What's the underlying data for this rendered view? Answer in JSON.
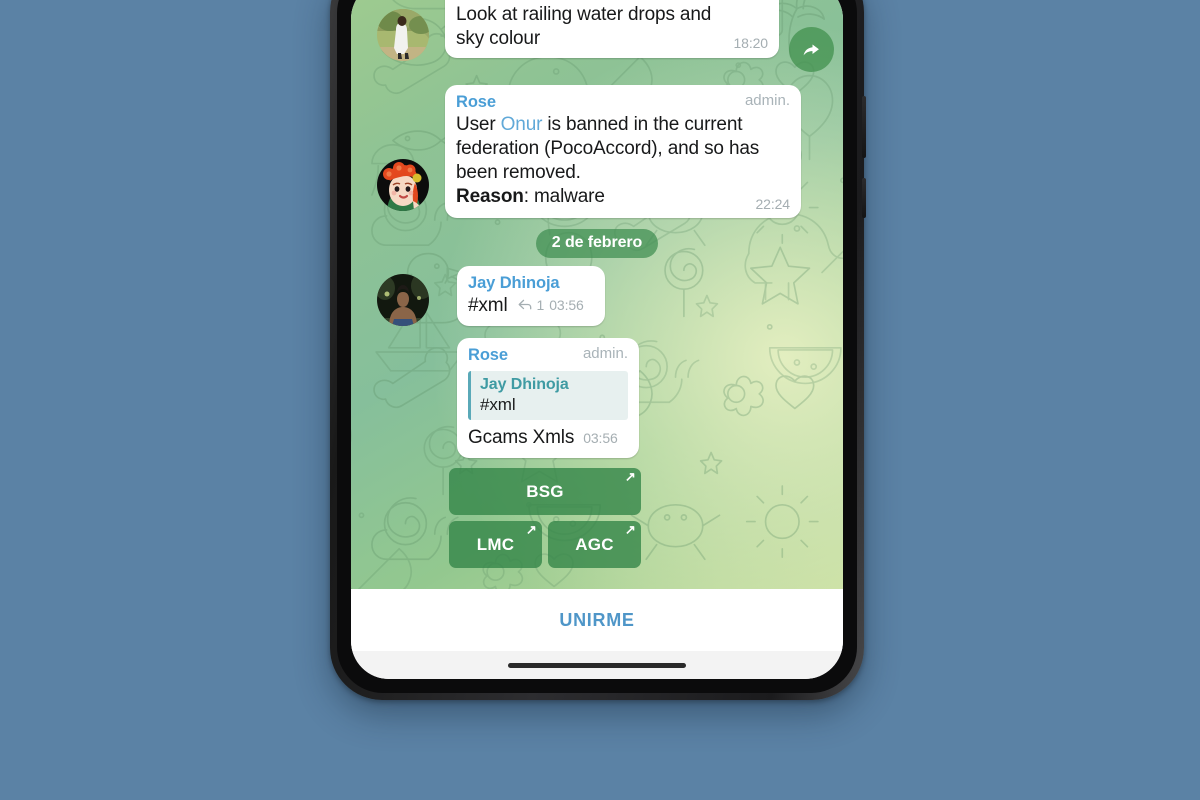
{
  "app": {
    "name": "Telegram",
    "platform": "Android phone mockup"
  },
  "theme": {
    "page_background": "#5b82a5",
    "chat_gradient_start": "#9fcb8f",
    "chat_gradient_end": "#c5dd9e",
    "bubble_background": "#ffffff",
    "sender_name_color": "#4a9ed6",
    "quote_accent_color": "#5aa9b8",
    "button_green": "#348649",
    "join_link_color": "#4f96c8",
    "time_color": "#a5aeb2"
  },
  "chat": {
    "messages": [
      {
        "id": "photo-message",
        "type": "photo",
        "caption": "Look at railing water drops and sky colour",
        "time": "18:20",
        "avatar_name": "avatar-person-white-outfit"
      },
      {
        "id": "ban-message",
        "type": "text",
        "sender": "Rose",
        "admin_tag": "admin.",
        "text_parts": {
          "p1": "User ",
          "mention": "Onur",
          "p2": " is banned in the current federation (PocoAccord), and so has been removed.",
          "reason_label": "Reason",
          "reason_value": ": malware"
        },
        "time": "22:24",
        "avatar_name": "avatar-rose-redhead"
      },
      {
        "id": "jay-message",
        "type": "text",
        "sender": "Jay Dhinoja",
        "text": "#xml",
        "reply_count": "1",
        "time": "03:56",
        "avatar_name": "avatar-jay-dhinoja"
      },
      {
        "id": "rose-reply-message",
        "type": "reply",
        "sender": "Rose",
        "admin_tag": "admin.",
        "quote_author": "Jay Dhinoja",
        "quote_text": "#xml",
        "text": "Gcams Xmls",
        "time": "03:56",
        "avatar_name": "avatar-rose-redhead"
      }
    ],
    "date_divider": "2 de febrero",
    "forward_button_icon": "forward-arrow-icon"
  },
  "keyboard": {
    "rows": [
      [
        {
          "label": "BSG",
          "external_icon": "↗"
        }
      ],
      [
        {
          "label": "LMC",
          "external_icon": "↗"
        },
        {
          "label": "AGC",
          "external_icon": "↗"
        }
      ]
    ]
  },
  "bottom_bar": {
    "join_label": "UNIRME"
  }
}
